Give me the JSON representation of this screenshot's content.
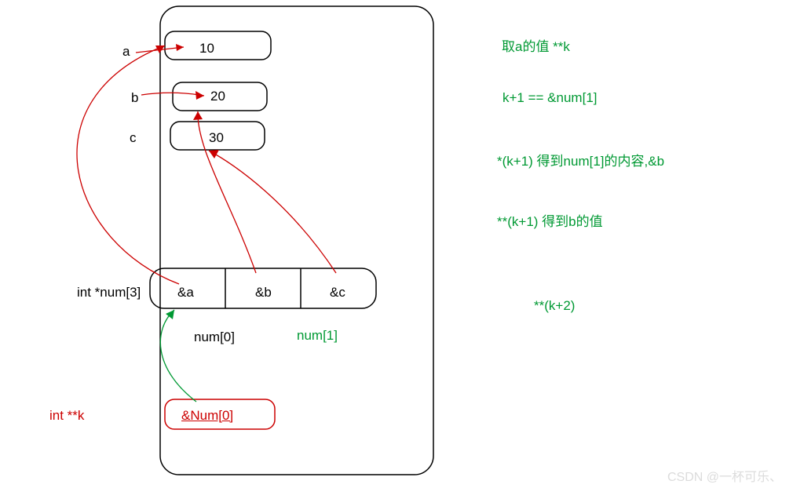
{
  "vars": {
    "a": {
      "name": "a",
      "value": "10"
    },
    "b": {
      "name": "b",
      "value": "20"
    },
    "c": {
      "name": "c",
      "value": "30"
    }
  },
  "array": {
    "decl": "int *num[3]",
    "cells": [
      "&a",
      "&b",
      "&c"
    ],
    "idx0": "num[0]",
    "idx1": "num[1]"
  },
  "k": {
    "decl": "int **k",
    "cell": "&Num[0]"
  },
  "notes": {
    "line1": "取a的值  **k",
    "line2": "k+1   ==    &num[1]",
    "line3": "*(k+1) 得到num[1]的内容,&b",
    "line4": "**(k+1)  得到b的值",
    "line5": "**(k+2)"
  },
  "watermark": "CSDN @一杯可乐、"
}
